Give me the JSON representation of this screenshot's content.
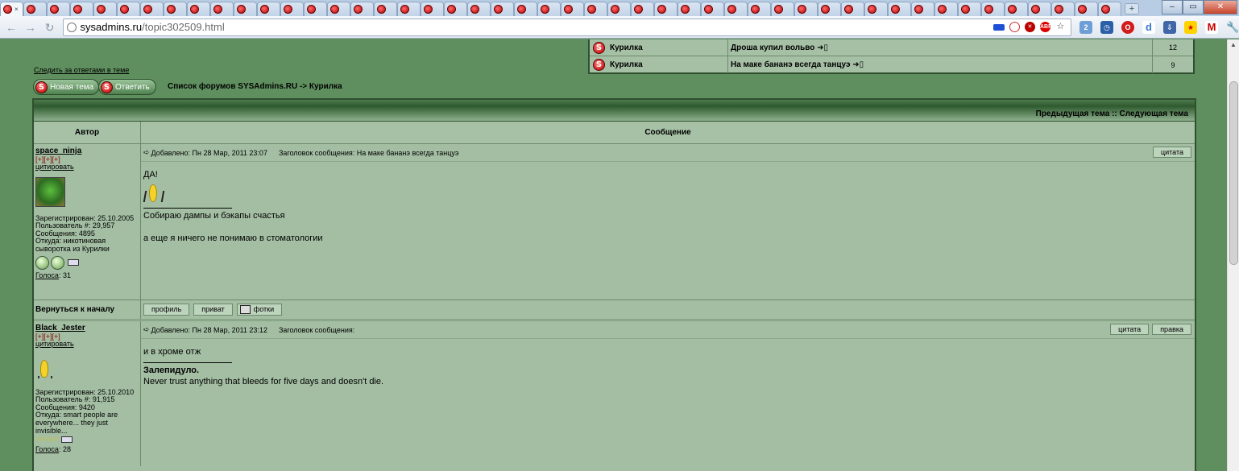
{
  "browser": {
    "url_host": "sysadmins.ru",
    "url_path": "/topic302509.html",
    "new_tab_label": "+",
    "tab_count": 48
  },
  "recent_topics": [
    {
      "forum": "Курилка",
      "title": "Дроша купил вольво ➜▯",
      "count": "12"
    },
    {
      "forum": "Курилка",
      "title": "На маке бананэ всегда танцуэ ➜▯",
      "count": "9"
    }
  ],
  "topic_actions": {
    "watch_link": "Следить за ответами в теме",
    "new_topic": "Новая тема",
    "reply": "Ответить",
    "breadcrumb": "Список форумов SYSAdmins.RU -> Курилка"
  },
  "table": {
    "prev_next": "Предыдущая тема :: Следующая тема",
    "col_author": "Автор",
    "col_message": "Сообщение"
  },
  "posts": [
    {
      "username": "space_ninja",
      "marks": "[+][+][+]",
      "quote_link": "цитировать",
      "registered": "Зарегистрирован: 25.10.2005",
      "user_no": "Пользователь #: 29,957",
      "messages": "Сообщения: 4895",
      "from": "Откуда: никотиновая сыворотка из Курилки",
      "votes_label": "Голоса",
      "votes_value": ": 31",
      "posted": "Добавлено: Пн 28 Мар, 2011 23:07",
      "subject": "Заголовок сообщения: На маке бананэ всегда танцуэ",
      "buttons": [
        "цитата"
      ],
      "body_top": "ДА!",
      "signature": "Собираю дампы и бэкапы счастья",
      "signature2": "а еще я ничего не понимаю в стоматологии",
      "back_to_top": "Вернуться к началу",
      "footer_buttons": [
        "профиль",
        "приват",
        "фотки"
      ]
    },
    {
      "username": "Black_Jester",
      "marks": "[+][+][+]",
      "quote_link": "цитировать",
      "registered": "Зарегистрирован: 25.10.2010",
      "user_no": "Пользователь #: 91,915",
      "messages": "Сообщения: 9420",
      "from": "Откуда: smart people are everywhere... they just invisible...",
      "stars": "☆☆☆☆",
      "votes_label": "Голоса",
      "votes_value": ": 28",
      "posted": "Добавлено: Пн 28 Мар, 2011 23:12",
      "subject": "Заголовок сообщения:",
      "buttons": [
        "цитата",
        "правка"
      ],
      "body_top": "и в хроме отж",
      "signature_bold": "Залепидуло.",
      "signature": "Never trust anything that bleeds for five days and doesn't die."
    }
  ]
}
